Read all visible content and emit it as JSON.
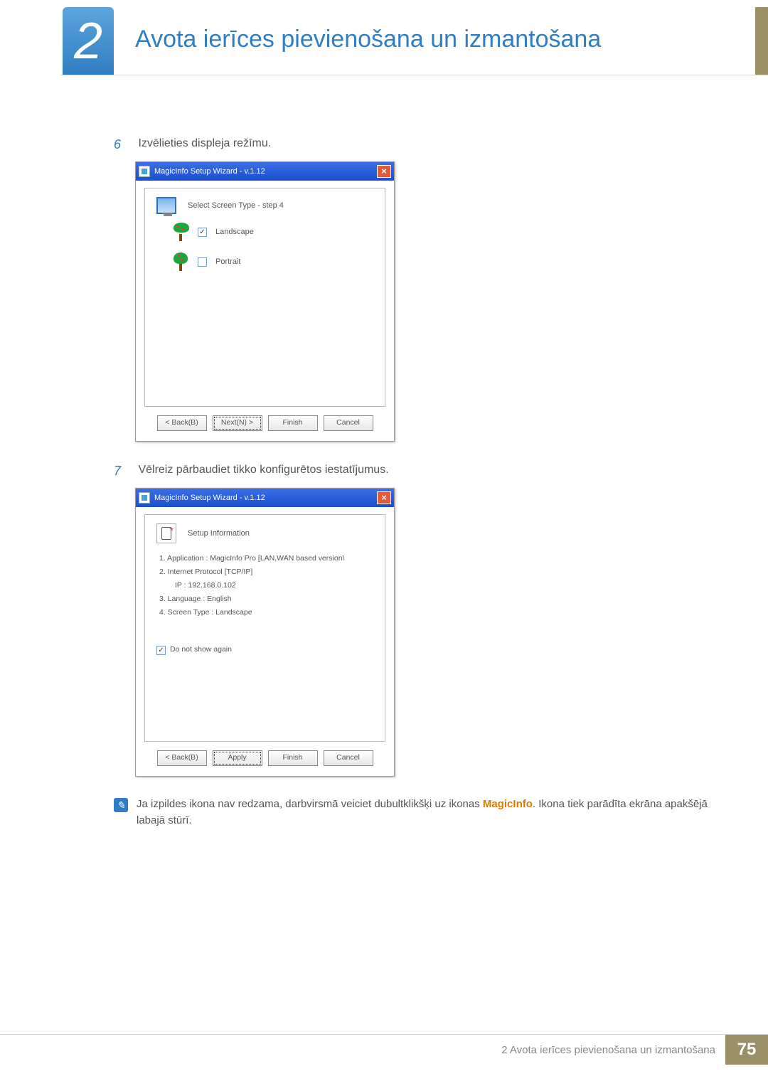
{
  "chapter": {
    "number": "2",
    "title": "Avota ierīces pievienošana un izmantošana"
  },
  "steps": {
    "s6": {
      "num": "6",
      "text": "Izvēlieties displeja režīmu."
    },
    "s7": {
      "num": "7",
      "text": "Vēlreiz pārbaudiet tikko konfigurētos iestatījumus."
    }
  },
  "dialog1": {
    "title": "MagicInfo Setup Wizard - v.1.12",
    "close": "×",
    "panelTitle": "Select Screen Type - step 4",
    "opt1": "Landscape",
    "opt2": "Portrait",
    "chk1": "✓",
    "chk2": "",
    "buttons": {
      "back": "< Back(B)",
      "next": "Next(N) >",
      "finish": "Finish",
      "cancel": "Cancel"
    }
  },
  "dialog2": {
    "title": "MagicInfo Setup Wizard - v.1.12",
    "close": "×",
    "panelTitle": "Setup Information",
    "info": {
      "l1": "1. Application :    MagicInfo Pro [LAN,WAN based version\\",
      "l2": "2. Internet Protocol [TCP/IP]",
      "l3": "IP :     192.168.0.102",
      "l4": "3. Language :    English",
      "l5": "4. Screen Type :    Landscape"
    },
    "noShowChk": "✓",
    "noShowLabel": "Do not show again",
    "buttons": {
      "back": "< Back(B)",
      "apply": "Apply",
      "finish": "Finish",
      "cancel": "Cancel"
    }
  },
  "note": {
    "before": "Ja izpildes ikona nav redzama, darbvirsmā veiciet dubultklikšķi uz ikonas ",
    "highlight": "MagicInfo",
    "after": ". Ikona tiek parādīta ekrāna apakšējā labajā stūrī."
  },
  "footer": {
    "text": "2 Avota ierīces pievienošana un izmantošana",
    "page": "75"
  }
}
